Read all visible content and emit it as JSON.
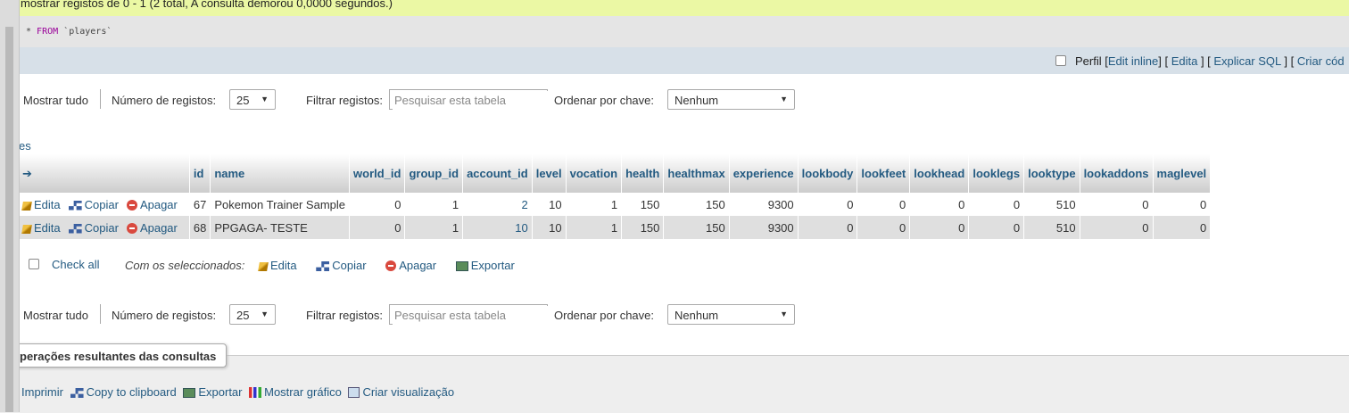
{
  "status": {
    "message": "mostrar registos de 0 - 1 (2 total, A consulta demorou 0,0000 segundos.)",
    "sql_keyword": "FROM",
    "sql_prefix": "* ",
    "sql_table": "`players`"
  },
  "profiling": {
    "perfil_label": "Perfil",
    "edit_inline": "Edit inline",
    "edita": "Edita",
    "explicar_sql": "Explicar SQL",
    "criar_codigo": "Criar cód"
  },
  "navigation": {
    "mostrar_tudo": "Mostrar tudo",
    "numero_registos_label": "Número de registos:",
    "numero_registos_value": "25",
    "filtrar_label": "Filtrar registos:",
    "filtrar_placeholder": "Pesquisar esta tabela",
    "ordenar_label": "Ordenar por chave:",
    "ordenar_value": "Nenhum"
  },
  "options_label": "es",
  "table": {
    "columns": [
      "id",
      "name",
      "world_id",
      "group_id",
      "account_id",
      "level",
      "vocation",
      "health",
      "healthmax",
      "experience",
      "lookbody",
      "lookfeet",
      "lookhead",
      "looklegs",
      "looktype",
      "lookaddons",
      "maglevel"
    ],
    "row_actions": {
      "edit": "Edita",
      "copy": "Copiar",
      "delete": "Apagar"
    },
    "rows": [
      [
        "67",
        "Pokemon Trainer Sample",
        "0",
        "1",
        "2",
        "10",
        "1",
        "150",
        "150",
        "9300",
        "0",
        "0",
        "0",
        "0",
        "510",
        "0",
        "0"
      ],
      [
        "68",
        "PPGAGA- TESTE",
        "0",
        "1",
        "10",
        "10",
        "1",
        "150",
        "150",
        "9300",
        "0",
        "0",
        "0",
        "0",
        "510",
        "0",
        "0"
      ]
    ]
  },
  "bulk": {
    "check_all": "Check all",
    "with_selected": "Com os seleccionados:",
    "edit": "Edita",
    "copy": "Copiar",
    "delete": "Apagar",
    "export": "Exportar"
  },
  "query_ops": {
    "title": "perações resultantes das consultas",
    "print": "Imprimir",
    "copy_clipboard": "Copy to clipboard",
    "export": "Exportar",
    "show_chart": "Mostrar gráfico",
    "create_view": "Criar visualização"
  }
}
